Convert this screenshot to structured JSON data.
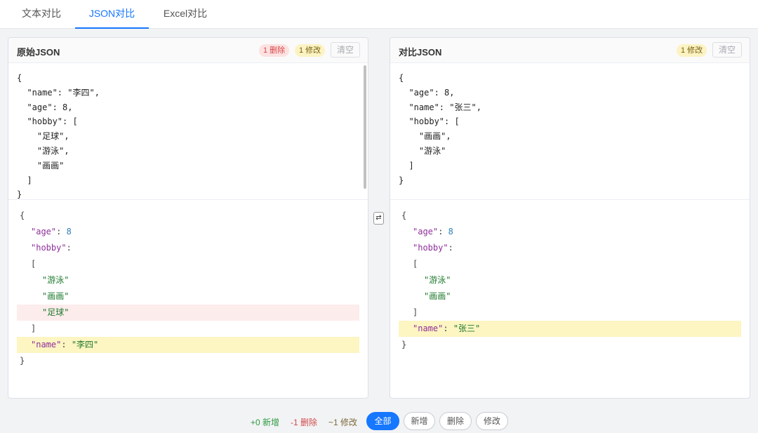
{
  "tabs": [
    "文本对比",
    "JSON对比",
    "Excel对比"
  ],
  "left": {
    "title": "原始JSON",
    "badge_del": "1 删除",
    "badge_mod": "1 修改",
    "clear": "清空",
    "editor_text": "{\n  \"name\": \"李四\",\n  \"age\": 8,\n  \"hobby\": [\n    \"足球\",\n    \"游泳\",\n    \"画画\"\n  ]\n}"
  },
  "right": {
    "title": "对比JSON",
    "badge_mod": "1 修改",
    "clear": "清空",
    "editor_text": "{\n  \"age\": 8,\n  \"name\": \"张三\",\n  \"hobby\": [\n    \"画画\",\n    \"游泳\"\n  ]\n}"
  },
  "diff_left": [
    {
      "parts": [
        [
          "p",
          "{"
        ]
      ],
      "indent": 0,
      "status": "none"
    },
    {
      "parts": [
        [
          "k",
          "\"age\""
        ],
        [
          "p",
          ": "
        ],
        [
          "n",
          "8"
        ]
      ],
      "indent": 1,
      "status": "none"
    },
    {
      "parts": [
        [
          "k",
          "\"hobby\""
        ],
        [
          "p",
          ":"
        ]
      ],
      "indent": 1,
      "status": "none"
    },
    {
      "parts": [
        [
          "p",
          "["
        ]
      ],
      "indent": 1,
      "status": "none"
    },
    {
      "parts": [
        [
          "s",
          "\"游泳\""
        ]
      ],
      "indent": 2,
      "status": "none"
    },
    {
      "parts": [
        [
          "s",
          "\"画画\""
        ]
      ],
      "indent": 2,
      "status": "none"
    },
    {
      "parts": [
        [
          "s",
          "\"足球\""
        ]
      ],
      "indent": 2,
      "status": "del"
    },
    {
      "parts": [
        [
          "p",
          "]"
        ]
      ],
      "indent": 1,
      "status": "none"
    },
    {
      "parts": [
        [
          "k",
          "\"name\""
        ],
        [
          "p",
          ": "
        ],
        [
          "s",
          "\"李四\""
        ]
      ],
      "indent": 1,
      "status": "mod"
    },
    {
      "parts": [
        [
          "p",
          "}"
        ]
      ],
      "indent": 0,
      "status": "none"
    }
  ],
  "diff_right": [
    {
      "parts": [
        [
          "p",
          "{"
        ]
      ],
      "indent": 0,
      "status": "none"
    },
    {
      "parts": [
        [
          "k",
          "\"age\""
        ],
        [
          "p",
          ": "
        ],
        [
          "n",
          "8"
        ]
      ],
      "indent": 1,
      "status": "none"
    },
    {
      "parts": [
        [
          "k",
          "\"hobby\""
        ],
        [
          "p",
          ":"
        ]
      ],
      "indent": 1,
      "status": "none"
    },
    {
      "parts": [
        [
          "p",
          "["
        ]
      ],
      "indent": 1,
      "status": "none"
    },
    {
      "parts": [
        [
          "s",
          "\"游泳\""
        ]
      ],
      "indent": 2,
      "status": "none"
    },
    {
      "parts": [
        [
          "s",
          "\"画画\""
        ]
      ],
      "indent": 2,
      "status": "none"
    },
    {
      "parts": [
        [
          "p",
          "]"
        ]
      ],
      "indent": 1,
      "status": "none"
    },
    {
      "parts": [
        [
          "k",
          "\"name\""
        ],
        [
          "p",
          ": "
        ],
        [
          "s",
          "\"张三\""
        ]
      ],
      "indent": 1,
      "status": "mod"
    },
    {
      "parts": [
        [
          "p",
          "}"
        ]
      ],
      "indent": 0,
      "status": "none"
    }
  ],
  "swap_icon": "⇄",
  "stats": {
    "add": "+0 新增",
    "del": "-1 删除",
    "mod": "~1 修改"
  },
  "filters": {
    "all": "全部",
    "add": "新增",
    "del": "删除",
    "mod": "修改"
  },
  "colors": {
    "accent": "#1677ff",
    "del_bg": "#fdecec",
    "mod_bg": "#fdf5c2"
  }
}
